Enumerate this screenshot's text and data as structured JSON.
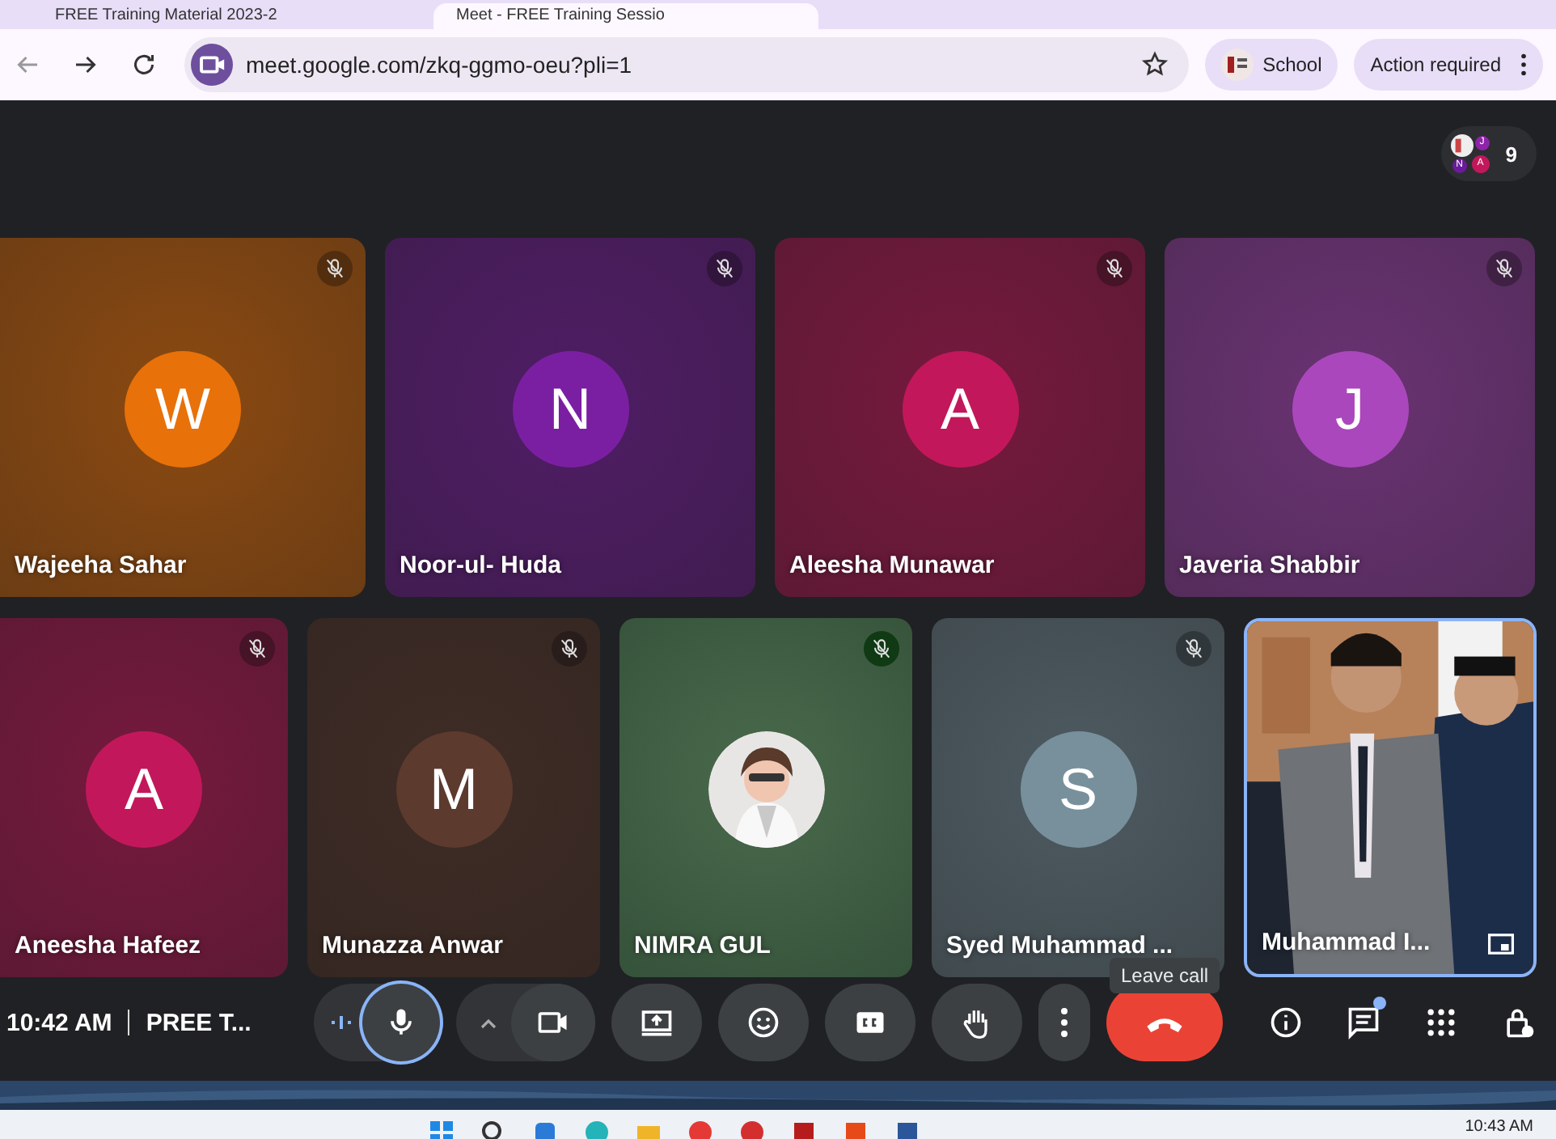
{
  "browser": {
    "tabs": [
      {
        "title": "FREE Training Material 2023-2",
        "selected": false
      },
      {
        "title": "Meet - FREE Training Sessio",
        "selected": true
      }
    ],
    "url": "meet.google.com/zkq-ggmo-oeu?pli=1",
    "profile": "School",
    "action": "Action required"
  },
  "participants_chip": {
    "avatars": [
      {
        "initial": "J",
        "color": "#8e24aa"
      },
      {
        "initial": "N",
        "color": "#6a1b9a"
      },
      {
        "initial": "A",
        "color": "#c2185b"
      }
    ],
    "count": "9"
  },
  "rows": [
    [
      {
        "name": "Wajeeha Sahar",
        "kind": "initial",
        "initial": "W",
        "color": "#e8710a",
        "muted": true,
        "highlighted": false
      },
      {
        "name": "Noor-ul- Huda",
        "kind": "initial",
        "initial": "N",
        "color": "#7b1fa2",
        "muted": true,
        "highlighted": false
      },
      {
        "name": "Aleesha Munawar",
        "kind": "initial",
        "initial": "A",
        "color": "#c2185b",
        "muted": true,
        "highlighted": false
      },
      {
        "name": "Javeria Shabbir",
        "kind": "initial",
        "initial": "J",
        "color": "#ab47bc",
        "muted": true,
        "highlighted": false
      }
    ],
    [
      {
        "name": "Aneesha Hafeez",
        "kind": "initial",
        "initial": "A",
        "color": "#c2185b",
        "muted": true,
        "highlighted": false
      },
      {
        "name": "Munazza Anwar",
        "kind": "initial",
        "initial": "M",
        "color": "#5d3a2e",
        "muted": true,
        "highlighted": false
      },
      {
        "name": "NIMRA GUL",
        "muted": true,
        "highlighted": false
      },
      {
        "name": "Syed Muhammad ...",
        "kind": "initial",
        "initial": "S",
        "color": "#78909c",
        "muted": true,
        "highlighted": false
      },
      {
        "name": "Muhammad I...",
        "kind": "video",
        "muted": false,
        "highlighted": true
      }
    ]
  ],
  "meeting": {
    "time": "10:42 AM",
    "title": "PREE T..."
  },
  "controls": [
    {
      "kind": "mic",
      "focused": true
    },
    {
      "kind": "camera",
      "focused": false
    },
    {
      "kind": "present",
      "focused": false
    },
    {
      "kind": "emoji",
      "focused": false
    },
    {
      "kind": "captions",
      "focused": false
    },
    {
      "kind": "hand",
      "focused": false
    },
    {
      "kind": "more",
      "focused": false
    },
    {
      "kind": "leave",
      "focused": false
    }
  ],
  "tooltip": "Leave call",
  "side_controls": [
    {
      "kind": "info",
      "notification": false
    },
    {
      "kind": "chat",
      "notification": true
    },
    {
      "kind": "apps",
      "notification": false
    },
    {
      "kind": "host",
      "notification": false
    }
  ],
  "taskbar": {
    "clock": "10:43 AM"
  }
}
